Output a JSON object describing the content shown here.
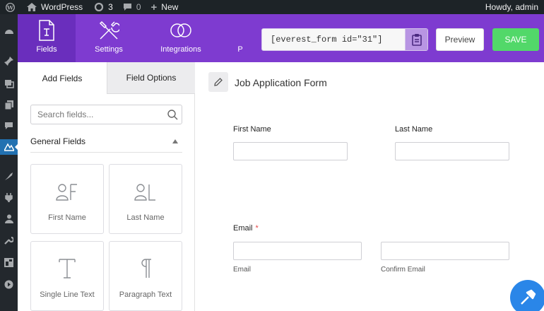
{
  "admin_bar": {
    "site_name": "WordPress",
    "updates_count": "3",
    "comments_count": "0",
    "new_label": "New",
    "howdy": "Howdy, admin"
  },
  "side_menu": {
    "icons": [
      "dashboard-icon",
      "posts-icon",
      "media-icon",
      "pages-icon",
      "comments-icon",
      "everest-forms-icon",
      "appearance-icon",
      "plugins-icon",
      "users-icon",
      "tools-icon",
      "settings-icon",
      "collapse-icon"
    ]
  },
  "header": {
    "tabs": [
      {
        "label": "Fields",
        "icon": "fields-icon"
      },
      {
        "label": "Settings",
        "icon": "settings-tools-icon"
      },
      {
        "label": "Integrations",
        "icon": "integrations-icon"
      },
      {
        "label": "P",
        "icon": ""
      }
    ],
    "shortcode": "[everest_form id=\"31\"]",
    "preview_label": "Preview",
    "save_label": "SAVE",
    "colors": {
      "header_bg": "#7e3bd0",
      "save_bg": "#52d869"
    }
  },
  "left_panel": {
    "tabs": [
      "Add Fields",
      "Field Options"
    ],
    "search_placeholder": "Search fields...",
    "section_title": "General Fields",
    "fields": [
      {
        "label": "First Name",
        "icon": "first-name-icon"
      },
      {
        "label": "Last Name",
        "icon": "last-name-icon"
      },
      {
        "label": "Single Line Text",
        "icon": "single-line-text-icon"
      },
      {
        "label": "Paragraph Text",
        "icon": "paragraph-text-icon"
      }
    ]
  },
  "form": {
    "title": "Job Application Form",
    "first_name_label": "First Name",
    "last_name_label": "Last Name",
    "email_label": "Email",
    "required_mark": "*",
    "email_sublabel": "Email",
    "confirm_email_sublabel": "Confirm Email"
  }
}
